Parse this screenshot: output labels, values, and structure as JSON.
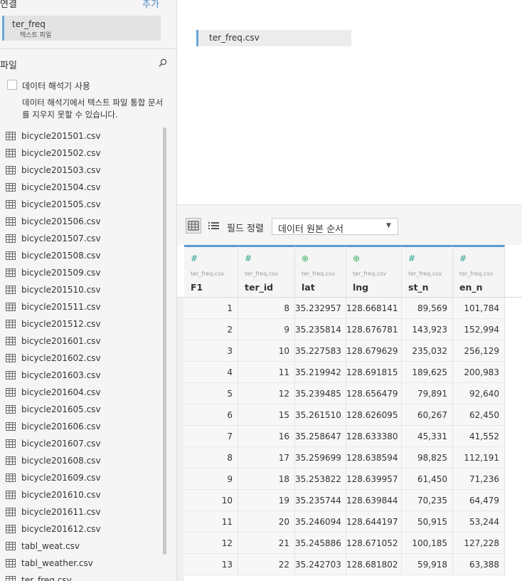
{
  "connections": {
    "title": "연결",
    "add_label": "추가",
    "items": [
      {
        "name": "ter_freq",
        "type": "텍스트 파일"
      }
    ]
  },
  "files": {
    "title": "파일",
    "search_icon": "search-icon",
    "interpreter_label": "데이터 해석기 사용",
    "interpreter_checked": false,
    "interpreter_desc": "데이터 해석기에서 텍스트 파일 통합 문서를 지우지 못할 수 있습니다.",
    "items": [
      "bicycle201501.csv",
      "bicycle201502.csv",
      "bicycle201503.csv",
      "bicycle201504.csv",
      "bicycle201505.csv",
      "bicycle201506.csv",
      "bicycle201507.csv",
      "bicycle201508.csv",
      "bicycle201509.csv",
      "bicycle201510.csv",
      "bicycle201511.csv",
      "bicycle201512.csv",
      "bicycle201601.csv",
      "bicycle201602.csv",
      "bicycle201603.csv",
      "bicycle201604.csv",
      "bicycle201605.csv",
      "bicycle201606.csv",
      "bicycle201607.csv",
      "bicycle201608.csv",
      "bicycle201609.csv",
      "bicycle201610.csv",
      "bicycle201611.csv",
      "bicycle201612.csv",
      "tabl_weat.csv",
      "tabl_weather.csv",
      "ter_freq.csv"
    ]
  },
  "canvas": {
    "table_label": "ter_freq.csv"
  },
  "toolbar": {
    "grid_view_icon": "grid-view-icon",
    "list_view_icon": "list-view-icon",
    "sort_label": "필드 정렬",
    "sort_value": "데이터 원본 순서"
  },
  "grid": {
    "accent_color": "#5b9bd5",
    "number_color": "#2ca58d",
    "geo_color": "#3dae5f",
    "columns": [
      {
        "type": "number",
        "type_glyph": "#",
        "source": "ter_freq.csv",
        "name": "F1"
      },
      {
        "type": "number",
        "type_glyph": "#",
        "source": "ter_freq.csv",
        "name": "ter_id"
      },
      {
        "type": "geo",
        "type_glyph": "⊕",
        "source": "ter_freq.csv",
        "name": "lat"
      },
      {
        "type": "geo",
        "type_glyph": "⊕",
        "source": "ter_freq.csv",
        "name": "lng"
      },
      {
        "type": "number",
        "type_glyph": "#",
        "source": "ter_freq.csv",
        "name": "st_n"
      },
      {
        "type": "number",
        "type_glyph": "#",
        "source": "ter_freq.csv",
        "name": "en_n"
      }
    ],
    "rows": [
      [
        "1",
        "8",
        "35.232957",
        "128.668141",
        "89,569",
        "101,784"
      ],
      [
        "2",
        "9",
        "35.235814",
        "128.676781",
        "143,923",
        "152,994"
      ],
      [
        "3",
        "10",
        "35.227583",
        "128.679629",
        "235,032",
        "256,129"
      ],
      [
        "4",
        "11",
        "35.219942",
        "128.691815",
        "189,625",
        "200,983"
      ],
      [
        "5",
        "12",
        "35.239485",
        "128.656479",
        "79,891",
        "92,640"
      ],
      [
        "6",
        "15",
        "35.261510",
        "128.626095",
        "60,267",
        "62,450"
      ],
      [
        "7",
        "16",
        "35.258647",
        "128.633380",
        "45,331",
        "41,552"
      ],
      [
        "8",
        "17",
        "35.259699",
        "128.638594",
        "98,825",
        "112,191"
      ],
      [
        "9",
        "18",
        "35.253822",
        "128.639957",
        "61,450",
        "71,236"
      ],
      [
        "10",
        "19",
        "35.235744",
        "128.639844",
        "70,235",
        "64,479"
      ],
      [
        "11",
        "20",
        "35.246094",
        "128.644197",
        "50,915",
        "53,244"
      ],
      [
        "12",
        "21",
        "35.245886",
        "128.671052",
        "100,185",
        "127,228"
      ],
      [
        "13",
        "22",
        "35.242703",
        "128.681802",
        "59,918",
        "63,388"
      ]
    ]
  }
}
